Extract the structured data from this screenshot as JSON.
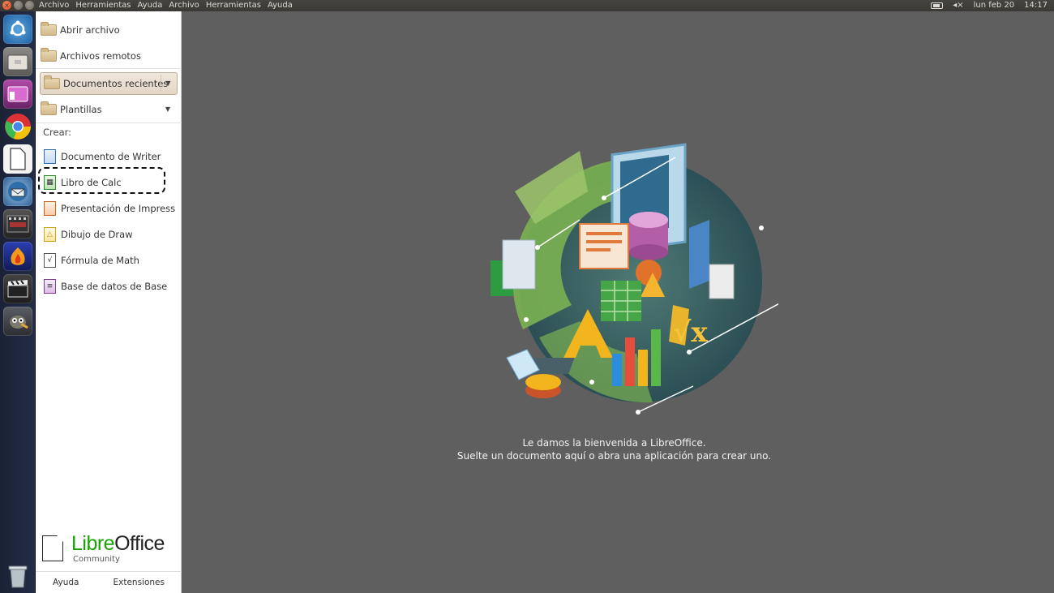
{
  "topbar": {
    "menus": [
      "Archivo",
      "Herramientas",
      "Ayuda",
      "Archivo",
      "Herramientas",
      "Ayuda"
    ],
    "date": "lun feb 20",
    "time": "14:17"
  },
  "launcher": {
    "apps": [
      "ubuntu-dash",
      "files",
      "image-viewer",
      "chrome",
      "libreoffice",
      "thunderbird",
      "video-editor",
      "audio-app",
      "clapper",
      "gimp",
      "trash"
    ]
  },
  "sidebar": {
    "open_file": "Abrir archivo",
    "remote_files": "Archivos remotos",
    "recent_docs": "Documentos recientes",
    "templates": "Plantillas",
    "create_label": "Crear:",
    "create_items": [
      "Documento de Writer",
      "Libro de Calc",
      "Presentación de Impress",
      "Dibujo de Draw",
      "Fórmula de Math",
      "Base de datos de Base"
    ],
    "logo_name_libre": "Libre",
    "logo_name_office": "Office",
    "logo_community": "Community",
    "help": "Ayuda",
    "extensions": "Extensiones"
  },
  "main": {
    "welcome_line1": "Le damos la bienvenida a LibreOffice.",
    "welcome_line2": "Suelte un documento aquí o abra una aplicación para crear uno."
  }
}
